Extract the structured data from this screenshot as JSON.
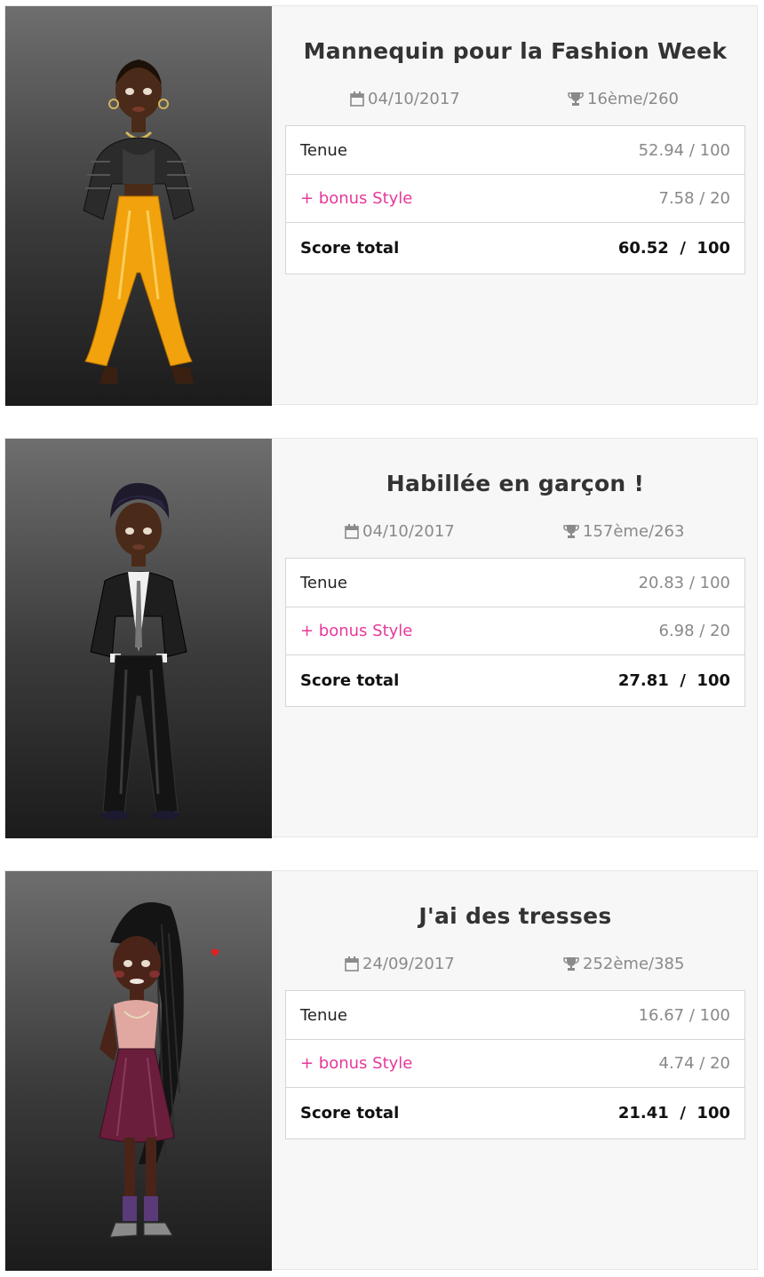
{
  "entries": [
    {
      "title": "Mannequin pour la Fashion Week",
      "date": "04/10/2017",
      "rank": "16ème/260",
      "outfit_label": "Tenue",
      "outfit_score": "52.94 / 100",
      "bonus_label": "+ bonus Style",
      "bonus_score": "7.58 / 20",
      "total_label": "Score total",
      "total_score": "60.52  /  100"
    },
    {
      "title": "Habillée en garçon !",
      "date": "04/10/2017",
      "rank": "157ème/263",
      "outfit_label": "Tenue",
      "outfit_score": "20.83 / 100",
      "bonus_label": "+ bonus Style",
      "bonus_score": "6.98 / 20",
      "total_label": "Score total",
      "total_score": "27.81  /  100"
    },
    {
      "title": "J'ai des tresses",
      "date": "24/09/2017",
      "rank": "252ème/385",
      "outfit_label": "Tenue",
      "outfit_score": "16.67 / 100",
      "bonus_label": "+ bonus Style",
      "bonus_score": "4.74 / 20",
      "total_label": "Score total",
      "total_score": "21.41  /  100"
    }
  ],
  "icons": {
    "date": "calendar-icon",
    "rank": "trophy-icon"
  },
  "colors": {
    "bonus": "#e5399a",
    "card_bg": "#f7f7f7",
    "photo_top": "#6e6e6e",
    "photo_bottom": "#1b1b1b"
  }
}
